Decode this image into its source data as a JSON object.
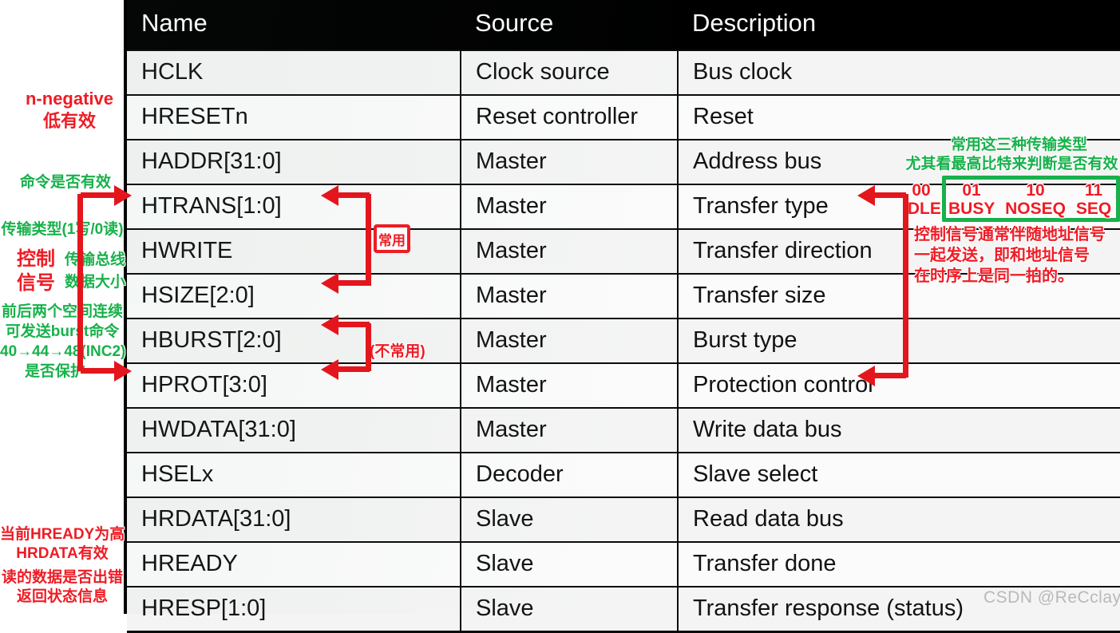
{
  "table": {
    "columns": [
      "Name",
      "Source",
      "Description"
    ],
    "rows": [
      {
        "name": "HCLK",
        "source": "Clock source",
        "description": "Bus clock"
      },
      {
        "name": "HRESETn",
        "source": "Reset controller",
        "description": "Reset"
      },
      {
        "name": "HADDR[31:0]",
        "source": "Master",
        "description": "Address bus"
      },
      {
        "name": "HTRANS[1:0]",
        "source": "Master",
        "description": "Transfer type"
      },
      {
        "name": "HWRITE",
        "source": "Master",
        "description": "Transfer direction"
      },
      {
        "name": "HSIZE[2:0]",
        "source": "Master",
        "description": "Transfer size"
      },
      {
        "name": "HBURST[2:0]",
        "source": "Master",
        "description": "Burst type"
      },
      {
        "name": "HPROT[3:0]",
        "source": "Master",
        "description": "Protection control"
      },
      {
        "name": "HWDATA[31:0]",
        "source": "Master",
        "description": "Write data bus"
      },
      {
        "name": "HSELx",
        "source": "Decoder",
        "description": "Slave select"
      },
      {
        "name": "HRDATA[31:0]",
        "source": "Slave",
        "description": "Read data bus"
      },
      {
        "name": "HREADY",
        "source": "Slave",
        "description": "Transfer done"
      },
      {
        "name": "HRESP[1:0]",
        "source": "Slave",
        "description": "Transfer response (status)"
      }
    ]
  },
  "annotations": {
    "left": {
      "reset_title": "n-negative",
      "reset_sub": "低有效",
      "htrans_label": "命令是否有效",
      "hwrite_label": "传输类型(1写/0读)",
      "control_word_1": "控制",
      "control_word_2": "信号",
      "hsize_label_1": "传输总线",
      "hsize_label_2": "数据大小",
      "hburst_label_1": "前后两个空间连续",
      "hburst_label_2": "可发送burst命令",
      "hburst_label_3": "40→44→48(INC2)",
      "hprot_label": "是否保护",
      "hready_label_1": "当前HREADY为高",
      "hready_label_2": "HRDATA有效",
      "hresp_label_1": "读的数据是否出错",
      "hresp_label_2": "返回状态信息"
    },
    "middle": {
      "common_badge": "常用",
      "uncommon_badge": "(不常用)"
    },
    "right": {
      "note_line_1": "常用这三种传输类型",
      "note_line_2": "尤其看最高比特来判断是否有效",
      "trans_types": [
        {
          "code": "00",
          "name": "IDLE"
        },
        {
          "code": "01",
          "name": "BUSY"
        },
        {
          "code": "10",
          "name": "NOSEQ"
        },
        {
          "code": "11",
          "name": "SEQ"
        }
      ],
      "ctrl_note_1": "控制信号通常伴随地址信号",
      "ctrl_note_2": "一起发送，即和地址信号",
      "ctrl_note_3": "在时序上是同一拍的。"
    }
  },
  "watermark": {
    "text": "CSDN @ReCclay"
  },
  "colors": {
    "red": "#ee1c25",
    "green": "#18b14b",
    "header_bg": "#000000",
    "header_fg": "#ffffff",
    "page_bg": "#ffffff"
  }
}
